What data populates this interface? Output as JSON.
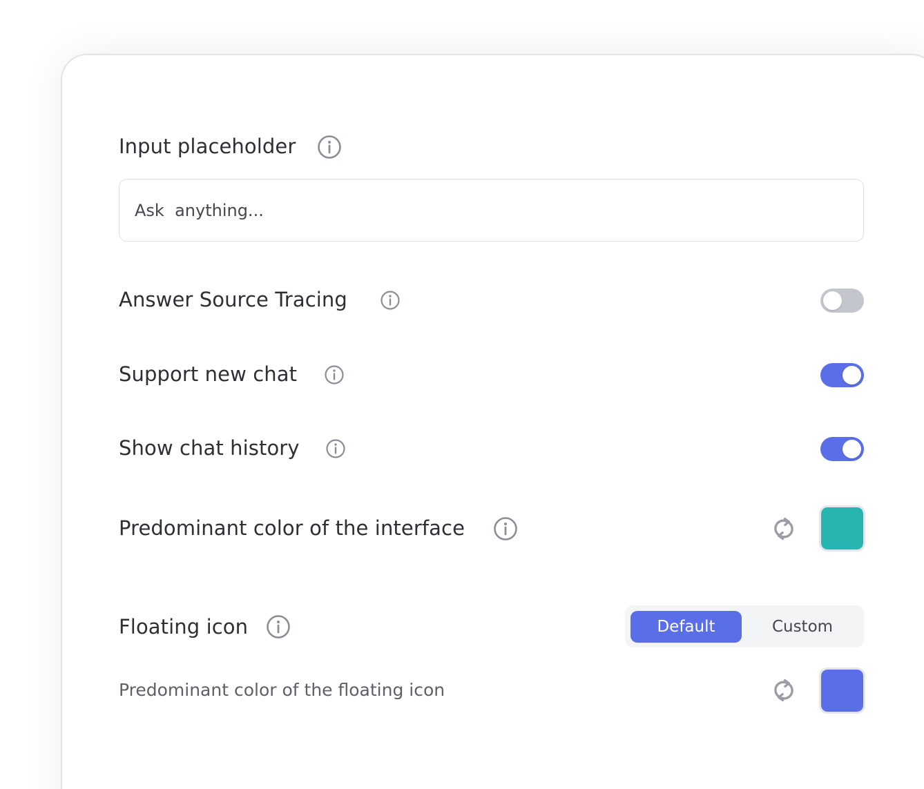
{
  "settings": {
    "placeholder_label": "Input placeholder",
    "placeholder_value": "Ask  anything...",
    "answer_source_tracing": {
      "label": "Answer Source Tracing",
      "enabled": false
    },
    "support_new_chat": {
      "label": "Support new chat",
      "enabled": true
    },
    "show_chat_history": {
      "label": "Show chat history",
      "enabled": true
    },
    "predominant_color": {
      "label": "Predominant color of the interface",
      "color": "#26b5b0"
    },
    "floating_icon": {
      "label": "Floating icon",
      "options": [
        "Default",
        "Custom"
      ],
      "selected": "Default",
      "color_label": "Predominant color of the floating icon",
      "color": "#5a6ee8"
    }
  },
  "icons": {
    "info": "info-circle-icon",
    "reset": "refresh-icon"
  },
  "colors": {
    "accent": "#5a6ee8",
    "toggle_off": "#c3c6cc",
    "text": "#2d2f34"
  }
}
